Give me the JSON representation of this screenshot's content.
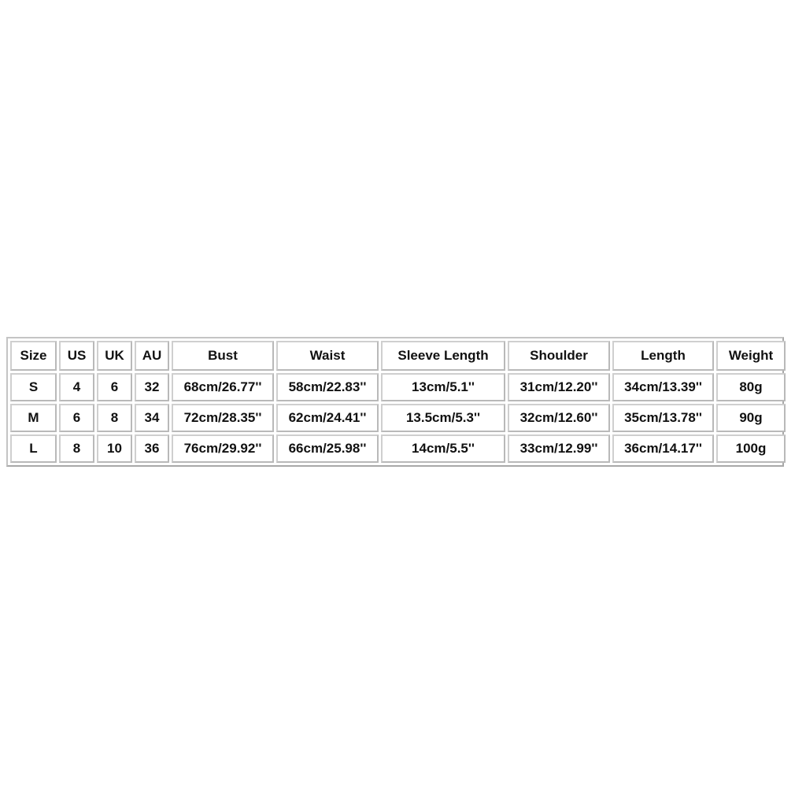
{
  "size_chart": {
    "headers": [
      "Size",
      "US",
      "UK",
      "AU",
      "Bust",
      "Waist",
      "Sleeve Length",
      "Shoulder",
      "Length",
      "Weight"
    ],
    "rows": [
      [
        "S",
        "4",
        "6",
        "32",
        "68cm/26.77''",
        "58cm/22.83''",
        "13cm/5.1''",
        "31cm/12.20''",
        "34cm/13.39''",
        "80g"
      ],
      [
        "M",
        "6",
        "8",
        "34",
        "72cm/28.35''",
        "62cm/24.41''",
        "13.5cm/5.3''",
        "32cm/12.60''",
        "35cm/13.78''",
        "90g"
      ],
      [
        "L",
        "8",
        "10",
        "36",
        "76cm/29.92''",
        "66cm/25.98''",
        "14cm/5.5''",
        "33cm/12.99''",
        "36cm/14.17''",
        "100g"
      ]
    ]
  }
}
